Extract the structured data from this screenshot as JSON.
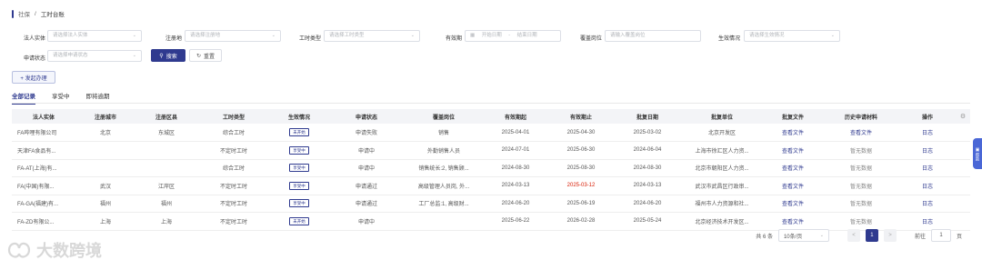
{
  "breadcrumb": {
    "root": "社保",
    "sep": "/",
    "current": "工时台账"
  },
  "filters": {
    "legal_entity": {
      "label": "法人实体",
      "placeholder": "请选择法人实体"
    },
    "registered_place": {
      "label": "注册地",
      "placeholder": "请选择注册地"
    },
    "work_type": {
      "label": "工时类型",
      "placeholder": "请选择工时类型"
    },
    "validity": {
      "label": "有效期",
      "start": "开始日期",
      "sep": "-",
      "end": "结束日期"
    },
    "position": {
      "label": "覆盖岗位",
      "placeholder": "请输入覆盖岗位"
    },
    "effective_status": {
      "label": "生效情况",
      "placeholder": "请选择生效情况"
    },
    "apply_status": {
      "label": "申请状态",
      "placeholder": "请选择申请状态"
    },
    "search_label": "搜索",
    "reset_label": "重置"
  },
  "new_button": "+ 发起办理",
  "tabs": [
    "全部记录",
    "享受中",
    "即将逾期"
  ],
  "table": {
    "headers": [
      "法人实体",
      "注册城市",
      "注册区县",
      "工时类型",
      "生效情况",
      "申请状态",
      "覆盖岗位",
      "有效期起",
      "有效期止",
      "批复日期",
      "批复单位",
      "批复文件",
      "历史申请材料",
      "操作"
    ],
    "rows": [
      [
        "FA哔哩有限公司",
        "北京",
        "东城区",
        "综合工时",
        "未开始",
        "申请失败",
        "销售",
        "2025-04-01",
        "2025-04-30",
        "2025-03-02",
        "北京开发区",
        "查看文件",
        "查看文件",
        "日志"
      ],
      [
        "天津FA食品有...",
        "",
        "",
        "不定时工时",
        "享受中",
        "申请中",
        "外勤销售人员",
        "2024-07-01",
        "2025-06-30",
        "2024-06-04",
        "上海市徐汇区人力资...",
        "查看文件",
        "暂无数据",
        "日志"
      ],
      [
        "FA-AT(上海)有...",
        "",
        "",
        "综合工时",
        "享受中",
        "申请中",
        "销售统长:2, 销售顾...",
        "2024-08-30",
        "2025-08-30",
        "2024-08-30",
        "北京市朝阳区人力资...",
        "查看文件",
        "暂无数据",
        "日志"
      ],
      [
        "FA(中国)有限...",
        "武汉",
        "江岸区",
        "不定时工时",
        "享受中",
        "申请通过",
        "高级管理人员岗, 外...",
        "2024-03-13",
        "2025-03-12",
        "2024-03-13",
        "武汉市武昌区行政审...",
        "查看文件",
        "暂无数据",
        "日志"
      ],
      [
        "FA-GA(福建)有...",
        "福州",
        "福州",
        "不定时工时",
        "享受中",
        "申请通过",
        "工厂总监:1, 高级财...",
        "2024-06-20",
        "2025-06-19",
        "2024-06-20",
        "福州市人力资源和社...",
        "查看文件",
        "暂无数据",
        "日志"
      ],
      [
        "FA-ZD有限公...",
        "上海",
        "上海",
        "不定时工时",
        "未开始",
        "申请中",
        "",
        "2025-06-22",
        "2026-02-28",
        "2025-05-24",
        "北京经济技术开发区...",
        "查看文件",
        "暂无数据",
        "日志"
      ]
    ]
  },
  "pagination": {
    "total": "共 6 条",
    "page_size": "10条/页",
    "prev": "<",
    "current": "1",
    "next": ">",
    "goto_label": "前往",
    "goto_value": "1",
    "page_suffix": "页"
  },
  "float_tab": "帮助",
  "watermark": "大数跨境",
  "colors": {
    "primary": "#2f3a8f",
    "overdue": "#d81e06"
  }
}
